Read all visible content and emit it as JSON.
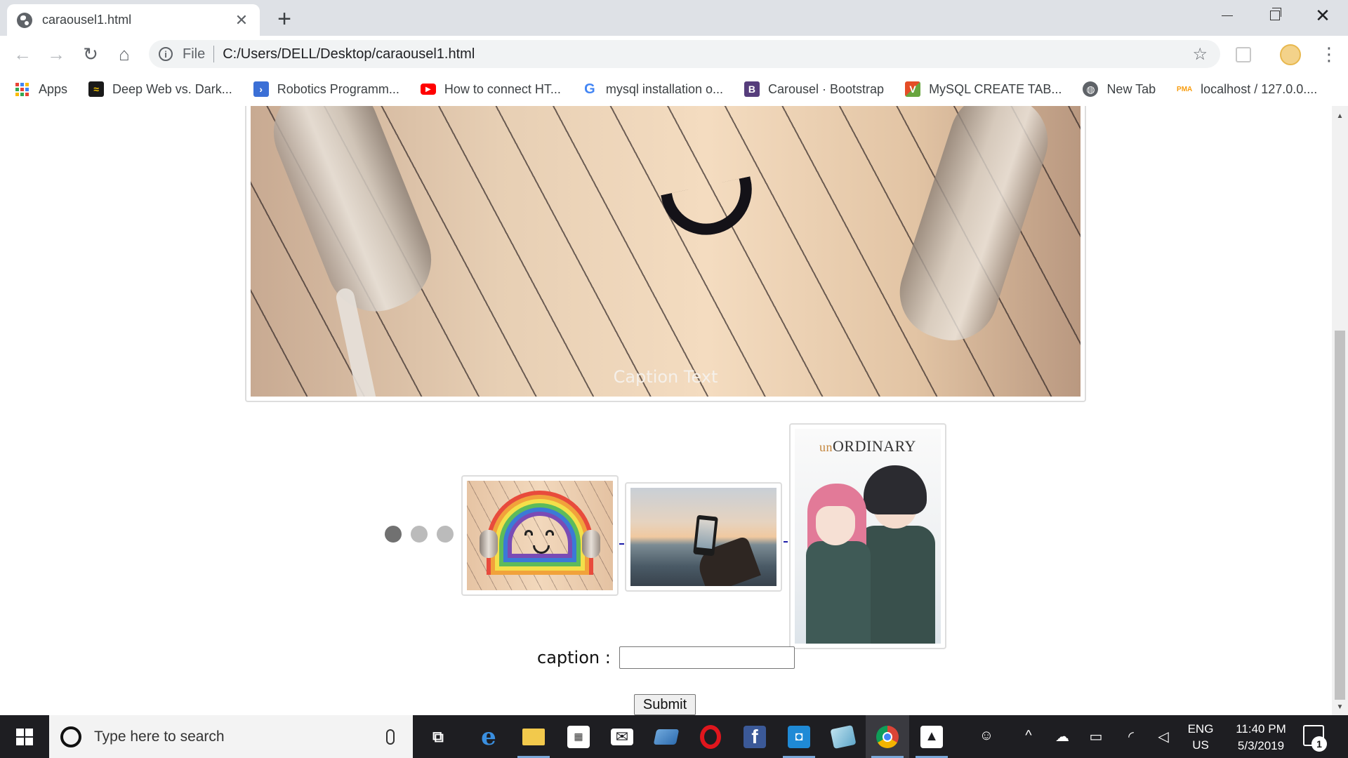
{
  "browser": {
    "tab": {
      "title": "caraousel1.html",
      "close_icon": "✕"
    },
    "new_tab_icon": "+",
    "window_controls": {
      "minimize": "minimize-icon",
      "maximize": "restore-icon",
      "close": "✕"
    },
    "address": {
      "security_label": "File",
      "url": "C:/Users/DELL/Desktop/caraousel1.html"
    },
    "bookmarks": [
      {
        "label": "Apps",
        "icon": "apps-grid-icon"
      },
      {
        "label": "Deep Web vs. Dark...",
        "icon": "deepweb-icon",
        "color": "#1a1a1a"
      },
      {
        "label": "Robotics Programm...",
        "icon": "robotics-icon",
        "color": "#3b6fd6"
      },
      {
        "label": "How to connect HT...",
        "icon": "youtube-icon",
        "color": "#ff0000"
      },
      {
        "label": "mysql installation o...",
        "icon": "google-icon",
        "color": "#4285f4"
      },
      {
        "label": "Carousel · Bootstrap",
        "icon": "bootstrap-icon",
        "color": "#563d7c"
      },
      {
        "label": "MySQL CREATE TAB...",
        "icon": "w3-icon",
        "color": "#e44d26"
      },
      {
        "label": "New Tab",
        "icon": "globe-icon",
        "color": "#5f6368"
      },
      {
        "label": "localhost / 127.0.0....",
        "icon": "phpmyadmin-icon",
        "color": "#f89c0e"
      }
    ]
  },
  "page": {
    "slide": {
      "caption": "Caption Text"
    },
    "thumbnails": [
      {
        "name": "rainbow-headphones"
      },
      {
        "name": "phone-at-sea"
      },
      {
        "name": "unordinary-cover",
        "title_prefix": "un",
        "title_main": "ORDINARY"
      }
    ],
    "dots": [
      {
        "active": true
      },
      {
        "active": false
      },
      {
        "active": false
      }
    ],
    "form": {
      "caption_label": "caption :",
      "caption_value": "",
      "submit_label": "Submit"
    }
  },
  "taskbar": {
    "search_placeholder": "Type here to search",
    "apps": [
      "task-view-icon",
      "edge-icon",
      "file-explorer-icon",
      "store-icon",
      "mail-icon",
      "app-icon",
      "opera-icon",
      "facebook-icon",
      "app-icon",
      "notes-icon",
      "chrome-icon",
      "photos-icon"
    ],
    "tray": {
      "language": "ENG",
      "region": "US",
      "time": "11:40 PM",
      "date": "5/3/2019",
      "notifications": "1"
    }
  }
}
